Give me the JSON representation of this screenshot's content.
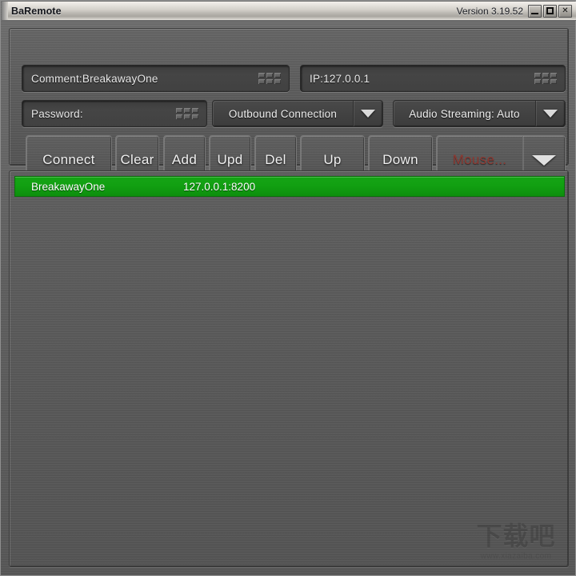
{
  "window": {
    "title": "BaRemote",
    "version": "Version 3.19.52",
    "controls": {
      "minimize": "_",
      "maximize": "□",
      "close": "✕"
    }
  },
  "fields": {
    "comment": {
      "value": "Comment:BreakawayOne",
      "placeholder": "Comment:"
    },
    "ip": {
      "value": "IP:127.0.0.1",
      "placeholder": "IP:"
    },
    "password": {
      "value": "Password:",
      "placeholder": "Password:"
    }
  },
  "combos": {
    "connection": {
      "value": "Outbound Connection",
      "arrow": "chevron-down-icon"
    },
    "audio": {
      "value": "Audio Streaming: Auto",
      "arrow": "chevron-down-icon"
    }
  },
  "buttons": {
    "connect": "Connect",
    "clear": "Clear",
    "add": "Add",
    "upd": "Upd",
    "del": "Del",
    "up": "Up",
    "down": "Down",
    "mouse": "Mouse..."
  },
  "list": {
    "rows": [
      {
        "name": "BreakawayOne",
        "address": "127.0.0.1:8200",
        "selected": true
      }
    ]
  },
  "watermark": {
    "text": "下载吧",
    "url": "www.xiazaiba.com"
  },
  "colors": {
    "selection_green": "#12a012",
    "mouse_button_red": "#8e3a33",
    "panel_gray": "#5a5a5a",
    "titlebar_silver": "#d2cfc9"
  }
}
